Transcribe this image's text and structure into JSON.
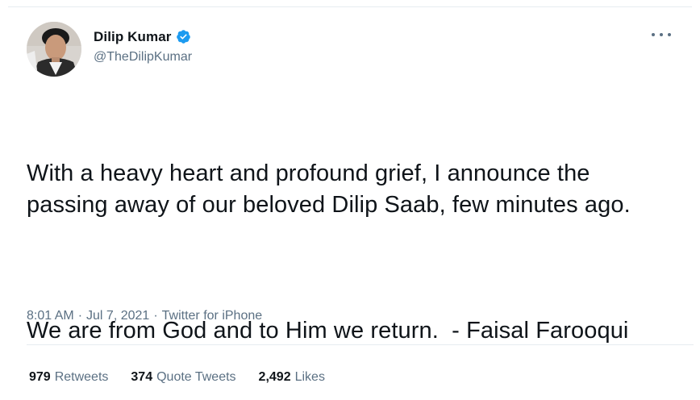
{
  "author": {
    "display_name": "Dilip Kumar",
    "handle": "@TheDilipKumar",
    "verified": true,
    "avatar_icon": "profile-photo"
  },
  "tweet": {
    "paragraph_1": "With a heavy heart and profound grief, I announce the passing away of our beloved Dilip Saab, few minutes ago.",
    "paragraph_2": "We are from God and to Him we return.  - Faisal Farooqui"
  },
  "meta": {
    "time": "8:01 AM",
    "separator": "·",
    "date": "Jul 7, 2021",
    "source": "Twitter for iPhone"
  },
  "stats": {
    "retweets": {
      "count": "979",
      "label": "Retweets"
    },
    "quote_tweets": {
      "count": "374",
      "label": "Quote Tweets"
    },
    "likes": {
      "count": "2,492",
      "label": "Likes"
    }
  },
  "colors": {
    "verified_blue": "#1d9bf0",
    "secondary_text": "#5b7083",
    "divider": "#e6ecf0"
  },
  "icons": {
    "more": "more-horizontal-icon",
    "verified": "verified-badge-icon"
  }
}
